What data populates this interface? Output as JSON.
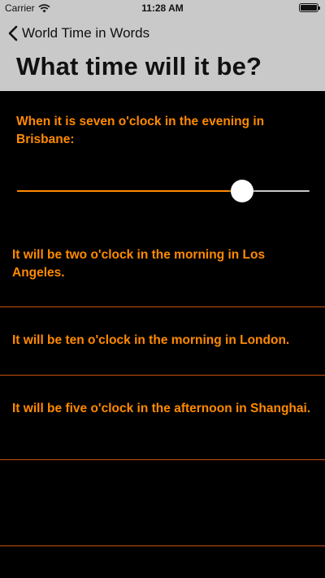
{
  "status_bar": {
    "carrier": "Carrier",
    "time": "11:28 AM",
    "battery_level": 1.0
  },
  "nav": {
    "back_label": "World Time in Words"
  },
  "page": {
    "title": "What time will it be?"
  },
  "prompt": {
    "text": "When it is seven o'clock in the evening in Brisbane:"
  },
  "slider": {
    "value": 0.77
  },
  "results": [
    {
      "text": "It will be two o'clock in the morning in Los Angeles."
    },
    {
      "text": "It will be ten o'clock in the morning in London."
    },
    {
      "text": "It will be five o'clock in the afternoon in Shanghai."
    }
  ],
  "colors": {
    "accent": "#ff8a00",
    "header_bg": "#c9c9c9",
    "background": "#000000",
    "divider": "#c84f10"
  }
}
